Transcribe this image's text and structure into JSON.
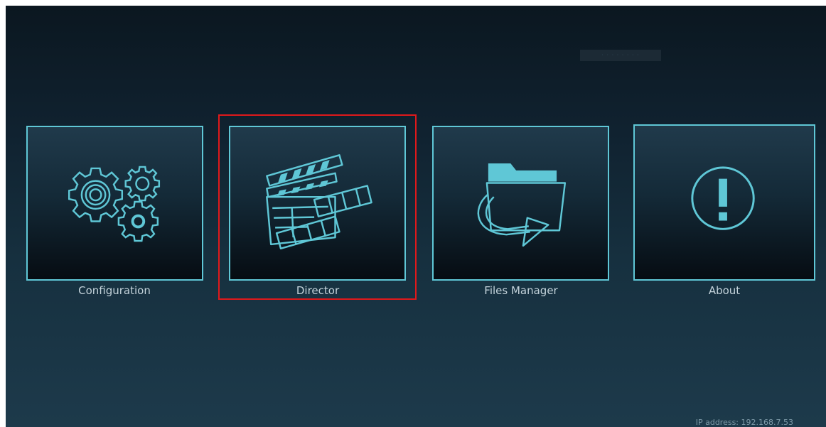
{
  "top_badge": {
    "text": "· · · · · · · ·"
  },
  "menu": {
    "items": [
      {
        "label": "Configuration",
        "icon": "gears-icon"
      },
      {
        "label": "Director",
        "icon": "clapperboard-icon"
      },
      {
        "label": "Files Manager",
        "icon": "folder-arrow-icon"
      },
      {
        "label": "About",
        "icon": "exclamation-circle-icon"
      }
    ],
    "selected_index": 1
  },
  "footer": {
    "ip_text": "IP address: 192.168.7.53"
  },
  "colors": {
    "accent": "#5fc7d6",
    "selection": "#e0191b",
    "label": "#c4d3db"
  }
}
